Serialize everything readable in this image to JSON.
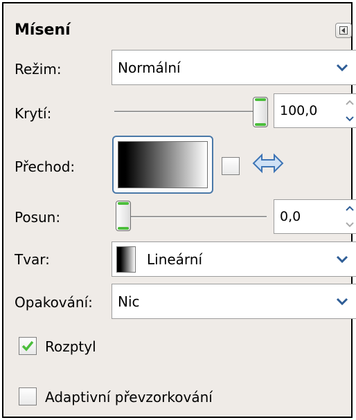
{
  "panel": {
    "title": "Mísení",
    "menu_icon": "tab-menu-icon"
  },
  "mode": {
    "label": "Režim:",
    "value": "Normální"
  },
  "opacity": {
    "label": "Krytí:",
    "value": "100,0",
    "fraction": 1.0
  },
  "gradient": {
    "label": "Přechod:",
    "reverse_icon": "reverse-arrows-icon"
  },
  "offset": {
    "label": "Posun:",
    "value": "0,0",
    "fraction": 0.0
  },
  "shape": {
    "label": "Tvar:",
    "value": "Lineární"
  },
  "repeat": {
    "label": "Opakování:",
    "value": "Nic"
  },
  "dither": {
    "label": "Rozptyl",
    "checked": true
  },
  "adaptive": {
    "label": "Adaptivní převzorkování",
    "checked": false
  },
  "colors": {
    "accent": "#4cbe3c",
    "combo_arrow": "#2e5d96",
    "panel_bg": "#efebe7"
  }
}
